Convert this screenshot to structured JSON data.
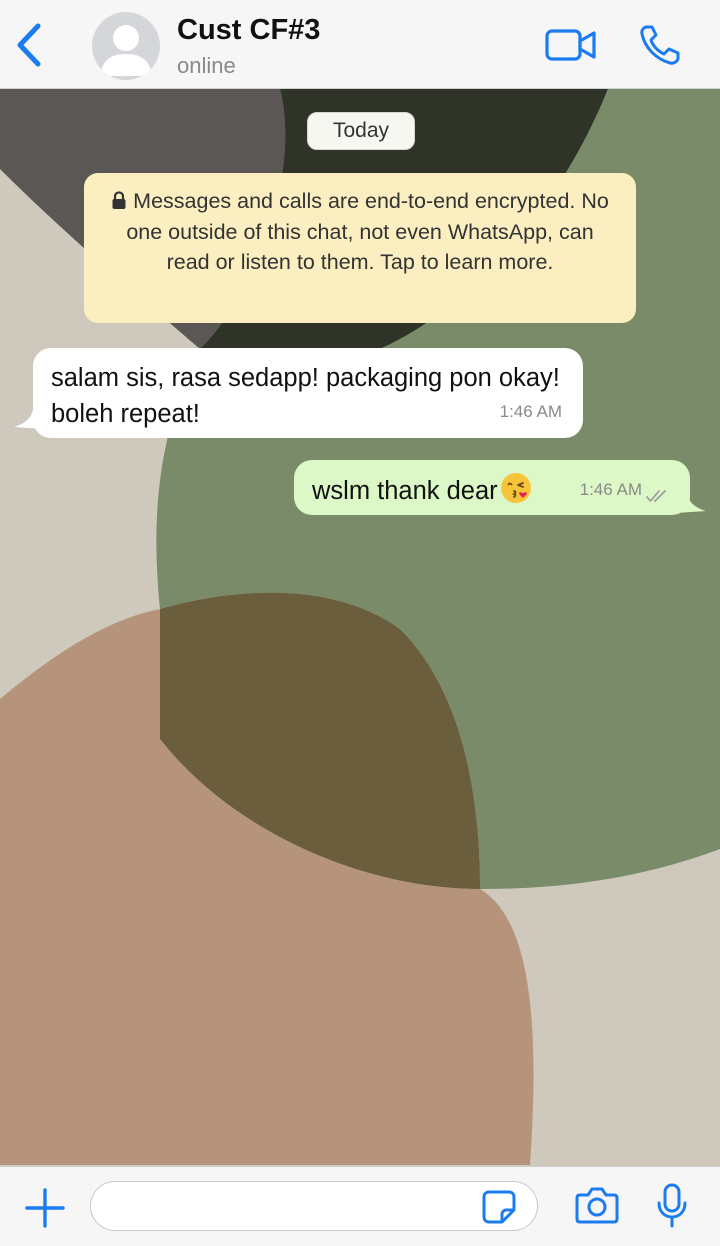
{
  "header": {
    "contact_name": "Cust CF#3",
    "status": "online",
    "accent_color": "#1a7cf0",
    "icons": [
      "back-chevron-icon",
      "avatar-placeholder-icon",
      "video-call-icon",
      "voice-call-icon"
    ]
  },
  "chat": {
    "date_pill": "Today",
    "encryption_notice": "Messages and calls are end-to-end encrypted. No one outside of this chat, not even WhatsApp, can read or listen to them. Tap to learn more.",
    "messages": [
      {
        "direction": "incoming",
        "text": "salam sis, rasa sedapp! packaging pon okay! boleh repeat!",
        "time": "1:46 AM"
      },
      {
        "direction": "outgoing",
        "text": "wslm thank dear",
        "emoji": "kissing-face-emoji",
        "time": "1:46 AM",
        "status": "read-double-tick"
      }
    ],
    "colors": {
      "incoming_bubble": "#ffffff",
      "outgoing_bubble": "#dcf8c6",
      "notice_bg": "#fbeec0"
    }
  },
  "composer": {
    "message_input_value": "",
    "icons": [
      "plus-icon",
      "sticker-icon",
      "camera-icon",
      "microphone-icon"
    ]
  }
}
